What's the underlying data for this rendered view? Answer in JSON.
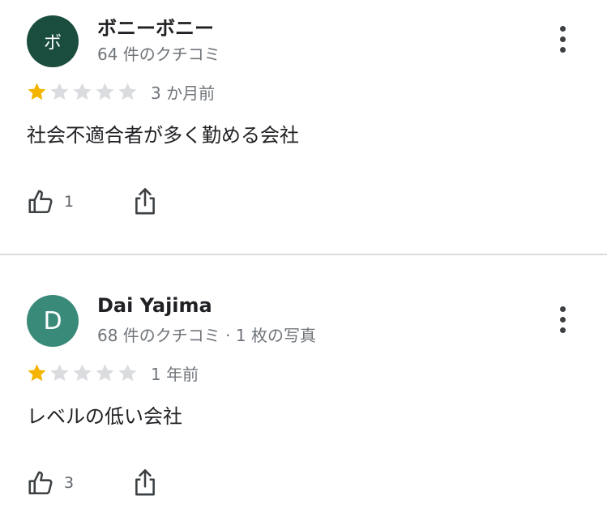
{
  "colors": {
    "star_filled": "#f4b400",
    "star_empty": "#dadce0",
    "secondary_text": "#70757a",
    "divider": "#dadce0"
  },
  "reviews": [
    {
      "avatar_letter": "ボ",
      "avatar_color": "#1b4d3e",
      "name": "ボニーボニー",
      "meta": "64 件のクチコミ",
      "rating": 1,
      "rating_max": 5,
      "time": "3 か月前",
      "text": "社会不適合者が多く勤める会社",
      "like_count": "1",
      "icons": {
        "like": "thumbs-up-icon",
        "share": "share-icon",
        "more": "more-vert-icon"
      }
    },
    {
      "avatar_letter": "D",
      "avatar_color": "#3a8a7a",
      "name": "Dai Yajima",
      "meta": "68 件のクチコミ · 1 枚の写真",
      "rating": 1,
      "rating_max": 5,
      "time": "1 年前",
      "text": "レベルの低い会社",
      "like_count": "3",
      "icons": {
        "like": "thumbs-up-icon",
        "share": "share-icon",
        "more": "more-vert-icon"
      }
    }
  ]
}
